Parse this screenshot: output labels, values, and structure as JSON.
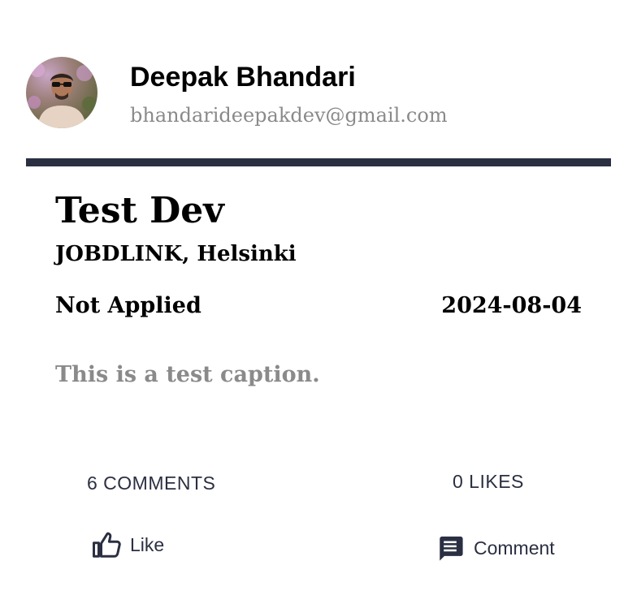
{
  "post": {
    "author": {
      "name": "Deepak Bhandari",
      "email": "bhandarideepakdev@gmail.com",
      "avatar_icon": "user-photo"
    },
    "job": {
      "title": "Test Dev",
      "company_location": "JOBDLINK, Helsinki",
      "status": "Not Applied",
      "date": "2024-08-04"
    },
    "caption": "This is a test caption.",
    "stats": {
      "comments_label": "6 COMMENTS",
      "likes_label": "0 LIKES"
    },
    "actions": {
      "like_label": "Like",
      "like_icon": "thumbs-up-icon",
      "comment_label": "Comment",
      "comment_icon": "comment-icon"
    }
  },
  "colors": {
    "divider": "#2b2f42",
    "muted_text": "#8a8a8a",
    "action_text": "#2b2f42"
  }
}
